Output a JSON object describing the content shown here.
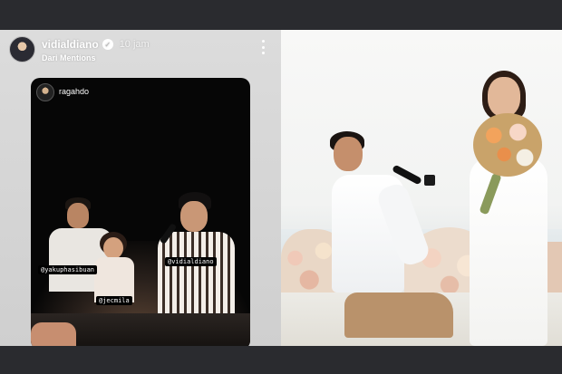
{
  "story": {
    "username": "vidialdiano",
    "time": "10 jam",
    "subtitle": "Dari Mentions",
    "repost": {
      "username": "ragahdo",
      "tags": [
        "@yakuphasibuan",
        "@vidialdiano",
        "@jecmila"
      ]
    }
  },
  "colors": {
    "background": "#2a2b2f",
    "story_panel": "#d6d6d6",
    "repost_card": "#060606"
  },
  "icons": [
    "verified-icon",
    "more-options-icon"
  ]
}
